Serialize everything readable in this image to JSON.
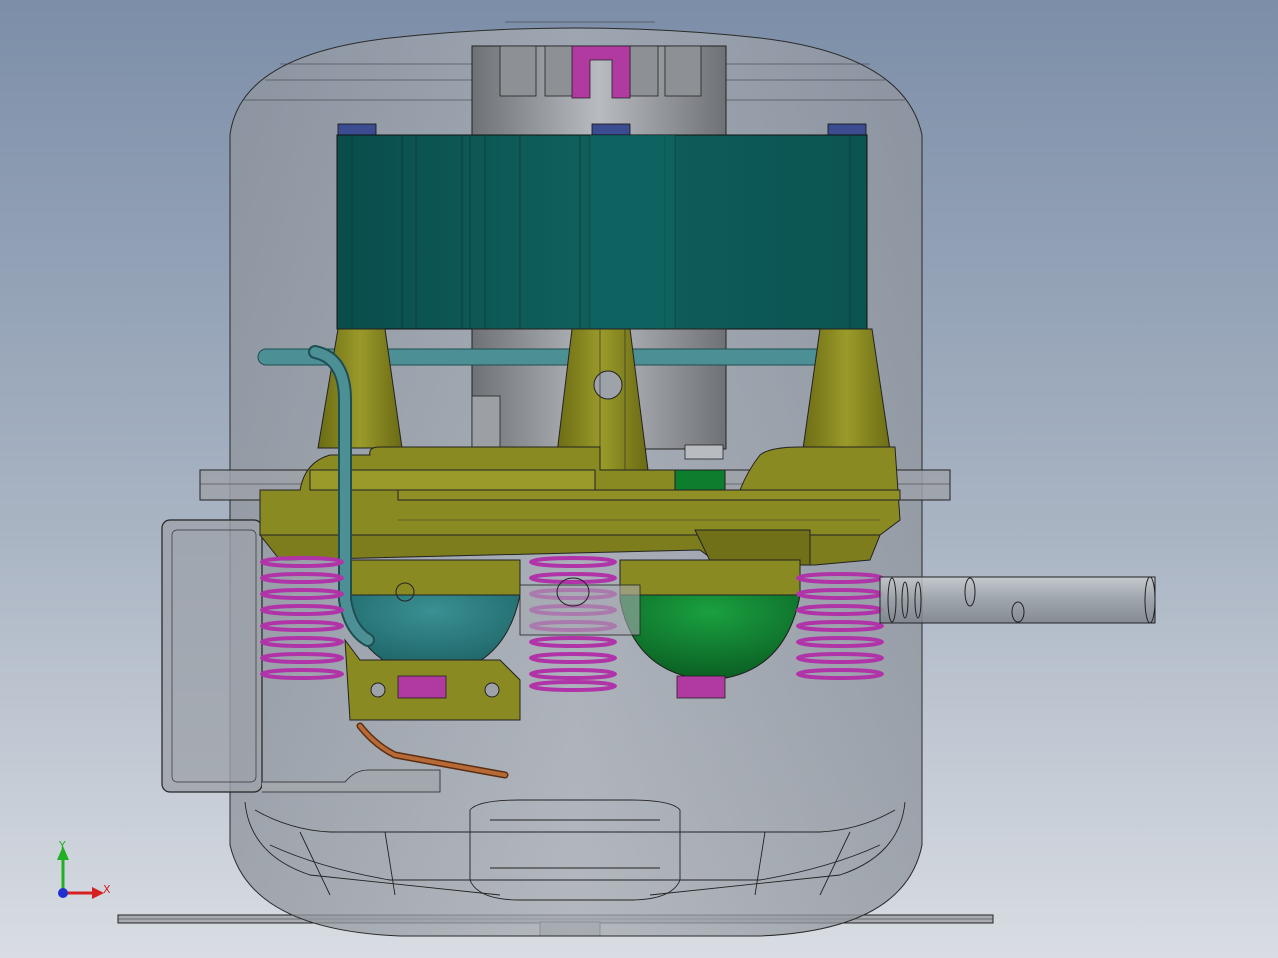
{
  "viewport": {
    "view_type": "3d-cad-model-viewport",
    "background_gradient": [
      "#7c8ea8",
      "#a9b4c3",
      "#d9dde3"
    ]
  },
  "model": {
    "colors": {
      "shell": "#a2a7ae",
      "motor_stator": "#0f5f5d",
      "crankcase": "#8a8a22",
      "springs": "#b034a8",
      "suction_muffler": "#0c7e2e",
      "cylinder_head": "#1f6f70",
      "pipes": "#9aa2aa",
      "discharge_tube": "#a35a2c",
      "bolts": "#3c4c90",
      "terminal_box": "#9aa0a6"
    }
  },
  "triad": {
    "x_label": "X",
    "y_label": "Y",
    "x_color": "#d42020",
    "y_color": "#22b022",
    "z_color": "#2030d0"
  }
}
